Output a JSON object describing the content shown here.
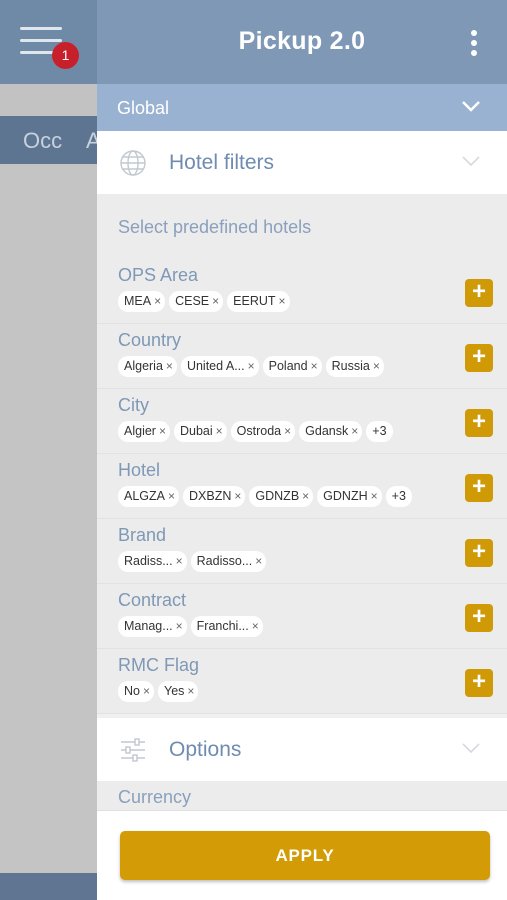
{
  "app": {
    "title": "Pickup 2.0",
    "notification_count": "1",
    "background_tabs": [
      "Occ",
      "A"
    ]
  },
  "global": {
    "label": "Global"
  },
  "hotel_filters": {
    "title": "Hotel filters",
    "predefined_label": "Select predefined hotels",
    "groups": [
      {
        "label": "OPS Area",
        "chips": [
          "MEA",
          "CESE",
          "EERUT"
        ]
      },
      {
        "label": "Country",
        "chips": [
          "Algeria",
          "United A...",
          "Poland",
          "Russia"
        ]
      },
      {
        "label": "City",
        "chips": [
          "Algier",
          "Dubai",
          "Ostroda",
          "Gdansk"
        ],
        "more": "+3"
      },
      {
        "label": "Hotel",
        "chips": [
          "ALGZA",
          "DXBZN",
          "GDNZB",
          "GDNZH"
        ],
        "more": "+3"
      },
      {
        "label": "Brand",
        "chips": [
          "Radiss...",
          "Radisso..."
        ]
      },
      {
        "label": "Contract",
        "chips": [
          "Manag...",
          "Franchi..."
        ]
      },
      {
        "label": "RMC Flag",
        "chips": [
          "No",
          "Yes"
        ]
      }
    ]
  },
  "options": {
    "title": "Options",
    "currency_label": "Currency"
  },
  "footer": {
    "apply_label": "APPLY"
  },
  "colors": {
    "header": "#7e98b6",
    "global_bar": "#9ab2d1",
    "accent_button": "#d39c06",
    "badge": "#c8202a"
  },
  "icons": {
    "menu": "hamburger-icon",
    "more": "kebab-icon",
    "hotel_filters": "globe-icon",
    "options": "sliders-icon",
    "expand": "chevron-down-icon",
    "add": "plus-icon",
    "remove": "close-icon"
  }
}
